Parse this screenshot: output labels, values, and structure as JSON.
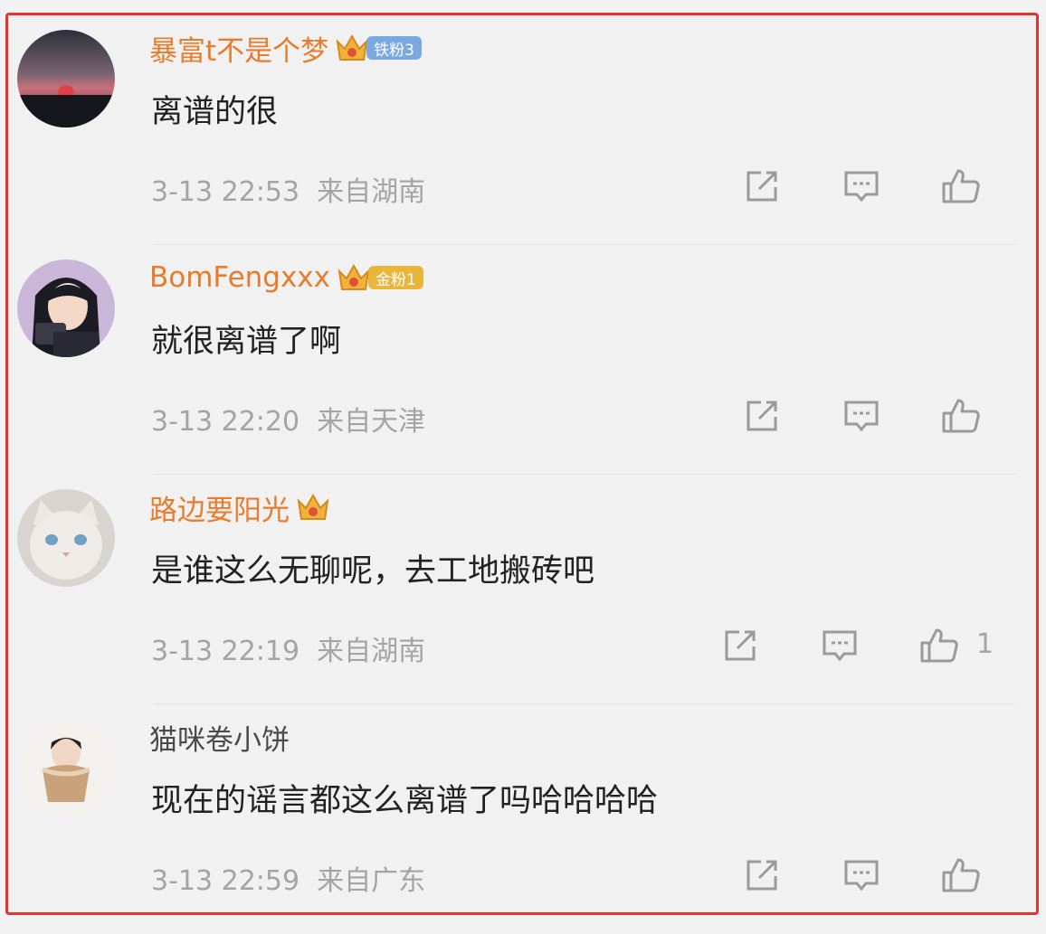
{
  "comments": [
    {
      "username": "暴富t不是个梦",
      "badge": "铁粉3",
      "badge_color": "#7aa9e0",
      "text": "离谱的很",
      "time": "3-13 22:53",
      "location": "来自湖南",
      "avatar": "sunset-avatar"
    },
    {
      "username": "BomFengxxx",
      "badge": "金粉1",
      "badge_color": "#e8b63a",
      "text": "就很离谱了啊",
      "time": "3-13 22:20",
      "location": "来自天津",
      "avatar": "anime-girl-avatar"
    },
    {
      "username": "路边要阳光",
      "text": "是谁这么无聊呢，去工地搬砖吧",
      "time": "3-13 22:19",
      "location": "来自湖南",
      "like_count": "1",
      "avatar": "cat-avatar"
    },
    {
      "username": "猫咪卷小饼",
      "text": "现在的谣言都这么离谱了吗哈哈哈哈",
      "time": "3-13 22:59",
      "location": "来自广东",
      "avatar": "girl-cupcake-avatar"
    }
  ],
  "icons": {
    "share": "share-icon",
    "reply": "comment-icon",
    "like": "thumbs-up-icon"
  },
  "colors": {
    "username": "#e87b2c",
    "frame": "#e8322e",
    "meta": "#a4a4a4"
  }
}
